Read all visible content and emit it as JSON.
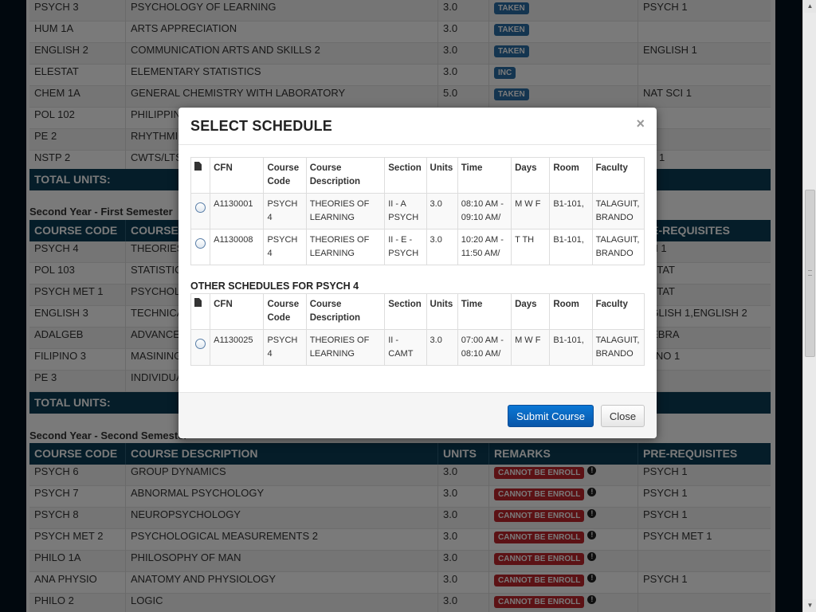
{
  "background": {
    "rows_top": [
      {
        "code": "PSYCH 3",
        "desc": "PSYCHOLOGY OF LEARNING",
        "units": "3.0",
        "remark": "TAKEN",
        "prereq": "PSYCH 1"
      },
      {
        "code": "HUM 1A",
        "desc": "ARTS APPRECIATION",
        "units": "3.0",
        "remark": "TAKEN",
        "prereq": ""
      },
      {
        "code": "ENGLISH 2",
        "desc": "COMMUNICATION ARTS AND SKILLS 2",
        "units": "3.0",
        "remark": "TAKEN",
        "prereq": "ENGLISH 1"
      },
      {
        "code": "ELESTAT",
        "desc": "ELEMENTARY STATISTICS",
        "units": "3.0",
        "remark": "INC",
        "prereq": ""
      },
      {
        "code": "CHEM 1A",
        "desc": "GENERAL CHEMISTRY WITH LABORATORY",
        "units": "5.0",
        "remark": "TAKEN",
        "prereq": "NAT SCI 1"
      },
      {
        "code": "POL 102",
        "desc": "PHILIPPIN",
        "units": "",
        "remark": "",
        "prereq": ""
      },
      {
        "code": "PE 2",
        "desc": "RHYTHMIC",
        "units": "",
        "remark": "",
        "prereq": "1"
      },
      {
        "code": "NSTP 2",
        "desc": "CWTS/LTS",
        "units": "",
        "remark": "",
        "prereq": "TP 1"
      }
    ],
    "total_label": "TOTAL UNITS:",
    "semester_1": "Second Year - First Semester",
    "headers": {
      "code": "COURSE CODE",
      "desc": "COURSE DESCRIPTION",
      "units": "UNITS",
      "remarks": "REMARKS",
      "prereq": "PRE-REQUISITES"
    },
    "headers_partial": {
      "code": "COURSE CODE",
      "desc": "COURSE",
      "prereq": "RE-REQUISITES"
    },
    "rows_mid": [
      {
        "code": "PSYCH 4",
        "desc": "THEORIES",
        "prereq": "CH 1"
      },
      {
        "code": "POL 103",
        "desc": "STATISTIC",
        "prereq": "ESTAT"
      },
      {
        "code": "PSYCH MET 1",
        "desc": "PSYCHOL",
        "prereq": "ESTAT"
      },
      {
        "code": "ENGLISH 3",
        "desc": "TECHNICA",
        "prereq": "NGLISH 1,ENGLISH 2"
      },
      {
        "code": "ADALGEB",
        "desc": "ADVANCE",
        "prereq": "GEBRA"
      },
      {
        "code": "FILIPINO 3",
        "desc": "MASINING",
        "prereq": "IPINO 1"
      },
      {
        "code": "PE 3",
        "desc": "INDIVIDUA",
        "prereq": "1"
      }
    ],
    "semester_2": "Second Year - Second Semester",
    "rows_bottom": [
      {
        "code": "PSYCH 6",
        "desc": "GROUP DYNAMICS",
        "units": "3.0",
        "remark": "CANNOT BE ENROLL",
        "prereq": "PSYCH 1"
      },
      {
        "code": "PSYCH 7",
        "desc": "ABNORMAL PSYCHOLOGY",
        "units": "3.0",
        "remark": "CANNOT BE ENROLL",
        "prereq": "PSYCH 1"
      },
      {
        "code": "PSYCH 8",
        "desc": "NEUROPSYCHOLOGY",
        "units": "3.0",
        "remark": "CANNOT BE ENROLL",
        "prereq": "PSYCH 1"
      },
      {
        "code": "PSYCH MET 2",
        "desc": "PSYCHOLOGICAL MEASUREMENTS 2",
        "units": "3.0",
        "remark": "CANNOT BE ENROLL",
        "prereq": "PSYCH MET 1"
      },
      {
        "code": "PHILO 1A",
        "desc": "PHILOSOPHY OF MAN",
        "units": "3.0",
        "remark": "CANNOT BE ENROLL",
        "prereq": ""
      },
      {
        "code": "ANA PHYSIO",
        "desc": "ANATOMY AND PHYSIOLOGY",
        "units": "3.0",
        "remark": "CANNOT BE ENROLL",
        "prereq": "PSYCH 1"
      },
      {
        "code": "PHILO 2",
        "desc": "LOGIC",
        "units": "3.0",
        "remark": "CANNOT BE ENROLL",
        "prereq": ""
      }
    ]
  },
  "modal": {
    "title": "SELECT SCHEDULE",
    "close_glyph": "×",
    "columns": [
      "CFN",
      "Course Code",
      "Course Description",
      "Section",
      "Units",
      "Time",
      "Days",
      "Room",
      "Faculty"
    ],
    "schedules": [
      {
        "cfn": "A1130001",
        "code": "PSYCH 4",
        "desc": "THEORIES OF LEARNING",
        "section": "II - A PSYCH",
        "units": "3.0",
        "time": "08:10 AM - 09:10 AM/",
        "days": "M W F",
        "room": "B1-101,",
        "faculty": "TALAGUIT, BRANDO"
      },
      {
        "cfn": "A1130008",
        "code": "PSYCH 4",
        "desc": "THEORIES OF LEARNING",
        "section": "II - E - PSYCH",
        "units": "3.0",
        "time": "10:20 AM - 11:50 AM/",
        "days": "T TH",
        "room": "B1-101,",
        "faculty": "TALAGUIT, BRANDO"
      }
    ],
    "other_title": "OTHER SCHEDULES FOR PSYCH 4",
    "other_schedules": [
      {
        "cfn": "A1130025",
        "code": "PSYCH 4",
        "desc": "THEORIES OF LEARNING",
        "section": "II - CAMT",
        "units": "3.0",
        "time": "07:00 AM - 08:10 AM/",
        "days": "M W F",
        "room": "B1-101,",
        "faculty": "TALAGUIT, BRANDO"
      }
    ],
    "submit_label": "Submit Course",
    "close_label": "Close"
  },
  "icons": {
    "file": "file-icon",
    "info": "info-icon"
  },
  "colors": {
    "header_bg": "#0b3d56",
    "taken": "#2a6fa8",
    "cannot": "#c0262d",
    "primary_btn": "#0a67c2"
  }
}
